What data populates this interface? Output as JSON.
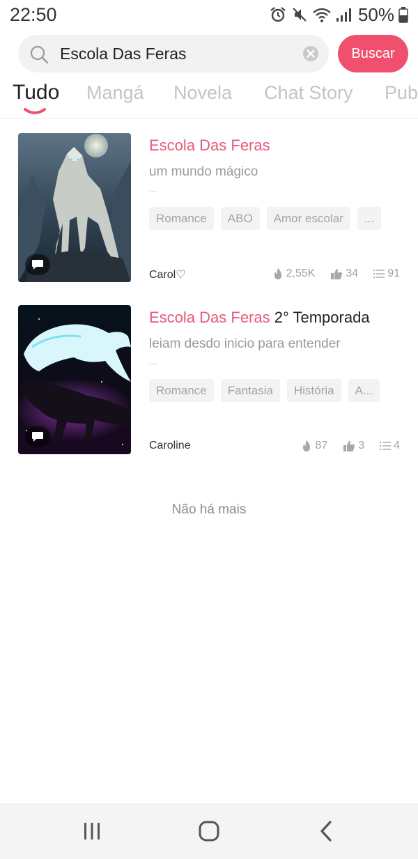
{
  "status_bar": {
    "time": "22:50",
    "battery": "50%"
  },
  "search": {
    "value": "Escola Das Feras",
    "button_label": "Buscar"
  },
  "tabs": [
    {
      "label": "Tudo",
      "active": true
    },
    {
      "label": "Mangá"
    },
    {
      "label": "Novela"
    },
    {
      "label": "Chat Story"
    },
    {
      "label": "Pub"
    }
  ],
  "results": [
    {
      "title_highlight": "Escola Das Feras",
      "title_rest": "",
      "description": "um mundo mágico",
      "ellipsis": "...",
      "tags": [
        "Romance",
        "ABO",
        "Amor escolar",
        "..."
      ],
      "author": "Carol♡",
      "views": "2,55K",
      "likes": "34",
      "chapters": "91"
    },
    {
      "title_highlight": "Escola Das Feras",
      "title_rest": " 2° Temporada",
      "description": "leiam desdo inicio para entender",
      "ellipsis": "...",
      "tags": [
        "Romance",
        "Fantasia",
        "História",
        "A..."
      ],
      "author": "Caroline",
      "views": "87",
      "likes": "3",
      "chapters": "4"
    }
  ],
  "footer": {
    "no_more": "Não há mais"
  },
  "colors": {
    "accent": "#f0506e",
    "highlight": "#e8587a"
  }
}
